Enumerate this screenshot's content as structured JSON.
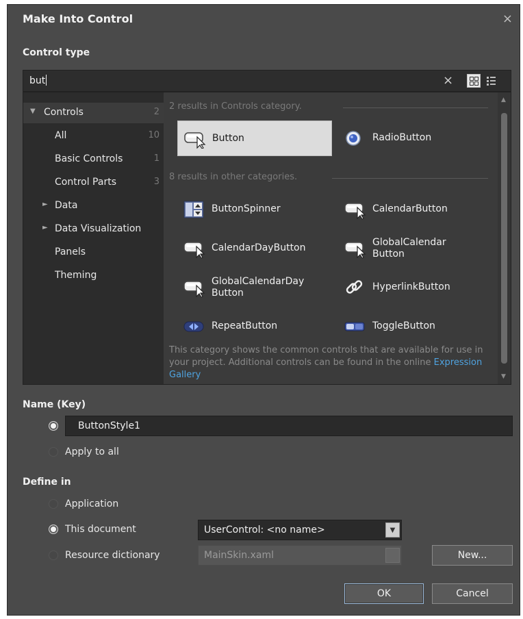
{
  "dialog": {
    "title": "Make Into Control",
    "close_glyph": "×"
  },
  "control_type": {
    "label": "Control type",
    "search_value": "but",
    "clear_glyph": "×"
  },
  "tree": [
    {
      "label": "Controls",
      "count": "2",
      "expander": "▼"
    },
    {
      "label": "All",
      "count": "10"
    },
    {
      "label": "Basic Controls",
      "count": "1"
    },
    {
      "label": "Control Parts",
      "count": "3"
    },
    {
      "label": "Data",
      "expander": "►"
    },
    {
      "label": "Data Visualization",
      "expander": "►"
    },
    {
      "label": "Panels"
    },
    {
      "label": "Theming"
    }
  ],
  "results": {
    "category_header": "2 results in Controls category.",
    "other_header": "8 results in other categories.",
    "category_items": [
      {
        "label": "Button",
        "icon": "button-icon"
      },
      {
        "label": "RadioButton",
        "icon": "radio-button-icon"
      }
    ],
    "other_items": [
      {
        "label": "ButtonSpinner",
        "icon": "button-spinner-icon"
      },
      {
        "label": "CalendarButton",
        "icon": "button-icon"
      },
      {
        "label": "CalendarDayButton",
        "icon": "button-icon"
      },
      {
        "label": "GlobalCalendar Button",
        "icon": "button-icon"
      },
      {
        "label": "GlobalCalendarDay Button",
        "icon": "button-icon"
      },
      {
        "label": "HyperlinkButton",
        "icon": "hyperlink-icon"
      },
      {
        "label": "RepeatButton",
        "icon": "repeat-button-icon"
      },
      {
        "label": "ToggleButton",
        "icon": "toggle-button-icon"
      }
    ],
    "description": "This category shows the common controls that are available for use in your project. Additional controls can be found in the online",
    "gallery_link": "Expression Gallery"
  },
  "name_key": {
    "label": "Name (Key)",
    "value": "ButtonStyle1",
    "apply_to_all": "Apply to all"
  },
  "define_in": {
    "label": "Define in",
    "application": "Application",
    "this_document": "This document",
    "this_document_value": "UserControl: <no name>",
    "resource_dictionary": "Resource dictionary",
    "resource_dictionary_value": "MainSkin.xaml",
    "new_button": "New..."
  },
  "footer": {
    "ok": "OK",
    "cancel": "Cancel"
  },
  "colors": {
    "dialog_bg": "#4a4a4a",
    "selected_tile": "#dcdcdc",
    "link": "#4fa3e0",
    "ok_focus_border": "#9ab8d8"
  }
}
